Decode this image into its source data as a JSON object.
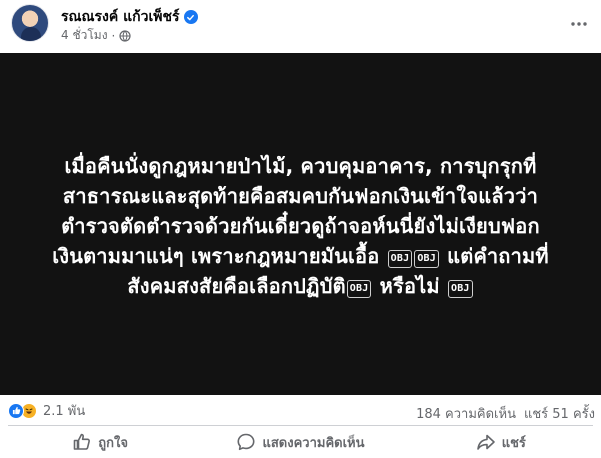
{
  "post": {
    "author": "รณณรงค์ แก้วเพ็ชร์",
    "time": "4 ชั่วโมง",
    "separator": "·",
    "text": {
      "line1": "เมื่อคืนนั่งดูกฎหมายป่าไม้, ควบคุมอาคาร, การบุกรุกที่",
      "line2": "สาธารณะและสุดท้ายคือสมคบกันฟอกเงินเข้าใจแล้วว่า",
      "line3": "ตำรวจตัดตำรวจด้วยกันเดี๋ยวดูถ้าจอห์นนี่ยังไม่เงียบฟอก",
      "line4a": "เงินตามมาแน่ๆ เพราะกฎหมายมันเอื้อ",
      "line4b": "แต่คำถามที่",
      "line5a": "สังคมสงสัยคือเลือกปฏิบัติ",
      "line5b": "หรือไม่",
      "obj": "OBJ"
    }
  },
  "stats": {
    "reaction_count": "2.1 พัน",
    "comments": "184 ความคิดเห็น",
    "shares": "แชร์ 51 ครั้ง"
  },
  "actions": {
    "like": "ถูกใจ",
    "comment": "แสดงความคิดเห็น",
    "share": "แชร์"
  },
  "icons": {
    "verified": "verified-badge-icon",
    "privacy": "globe-icon",
    "more": "more-options-icon",
    "like_reaction": "like-reaction-icon",
    "haha_reaction": "haha-reaction-icon",
    "like_action": "thumbs-up-icon",
    "comment_action": "comment-bubble-icon",
    "share_action": "share-arrow-icon"
  },
  "colors": {
    "accent": "#1877f2",
    "media_background": "#121212",
    "secondary_text": "#65676b"
  }
}
